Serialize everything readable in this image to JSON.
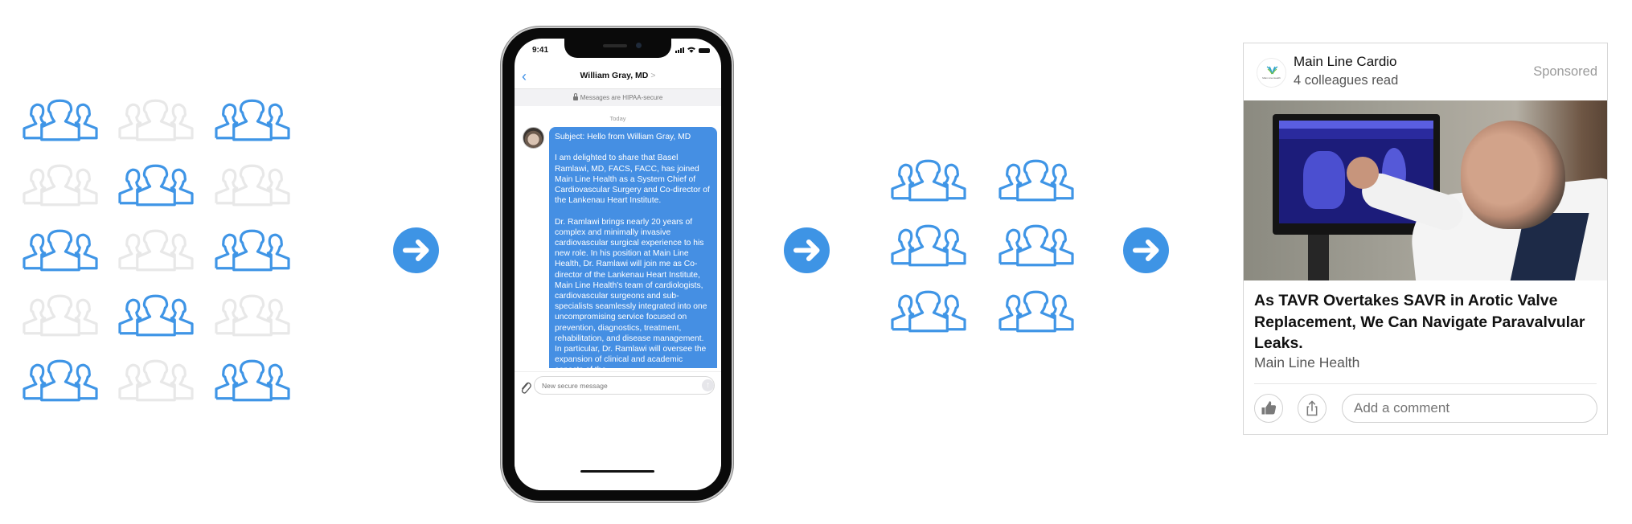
{
  "diagram": {
    "description": "Targeting funnel: audience grid to secure message to engaged audience to sponsored content",
    "colors": {
      "accent": "#3f95e6",
      "inactive": "#e8e8e8",
      "arrow": "#3e94e5",
      "bubble": "#458fe3"
    },
    "audience_grid": {
      "icon": "people-group-icon",
      "columns": 3,
      "rows": 5,
      "states": [
        [
          "active",
          "inactive",
          "active"
        ],
        [
          "inactive",
          "active",
          "inactive"
        ],
        [
          "active",
          "inactive",
          "active"
        ],
        [
          "inactive",
          "active",
          "inactive"
        ],
        [
          "active",
          "inactive",
          "active"
        ]
      ]
    },
    "arrows": [
      {
        "icon": "arrow-right-circle-icon"
      },
      {
        "icon": "arrow-right-circle-icon"
      },
      {
        "icon": "arrow-right-circle-icon"
      }
    ],
    "engaged_group": {
      "icon": "people-group-icon",
      "columns": 2,
      "rows": 3,
      "count": 6,
      "state": "active"
    }
  },
  "phone": {
    "status_time": "9:41",
    "contact_name": "William Gray, MD",
    "contact_chevron": ">",
    "back_icon": "chevron-left-icon",
    "security_banner": "Messages are HIPAA-secure",
    "day_label": "Today",
    "message": {
      "subject": "Subject: Hello from William Gray, MD",
      "paragraphs": [
        "I am delighted to share that Basel Ramlawi, MD, FACS, FACC, has joined Main Line Health as a System Chief of Cardiovascular Surgery and Co-director of the Lankenau Heart Institute.",
        "Dr. Ramlawi brings nearly 20 years of complex and minimally invasive cardiovascular surgical experience to his new role. In his position at Main Line Health, Dr. Ramlawi will join me as Co-director of the Lankenau Heart Institute, Main Line Health's team of cardiologists, cardiovascular surgeons and sub-specialists seamlessly integrated into one uncompromising service focused on prevention, diagnostics, treatment, rehabilitation, and disease management. In particular, Dr. Ramlawi will oversee the expansion of clinical and academic aspects of the"
      ]
    },
    "compose_placeholder": "New secure message",
    "send_icon": "arrow-up-icon",
    "attach_icon": "paperclip-icon"
  },
  "ad": {
    "publisher": "Main Line Cardio",
    "social_proof": "4 colleagues read",
    "sponsored_label": "Sponsored",
    "logo_text": "Main Line Health",
    "image_alt": "Physician in white coat pointing at cardiac CT scan on monitor",
    "title": "As TAVR Overtakes SAVR in Arotic Valve Replacement, We Can Navigate Paravalvular Leaks.",
    "source": "Main Line Health",
    "like_icon": "thumbs-up-icon",
    "share_icon": "share-icon",
    "comment_placeholder": "Add a comment"
  }
}
